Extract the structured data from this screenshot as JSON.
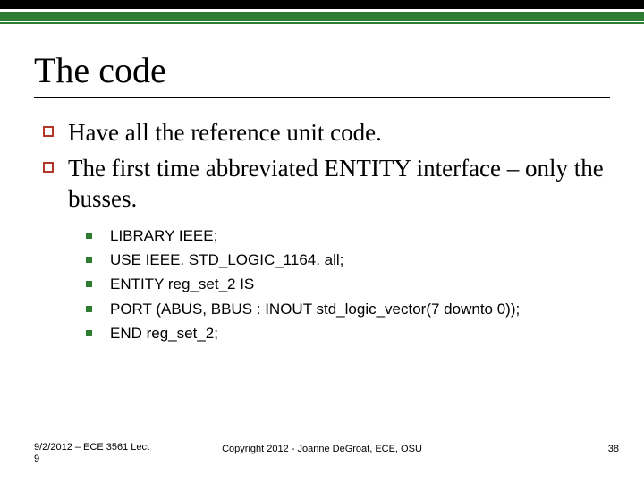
{
  "title": "The code",
  "bullets": [
    {
      "text": "Have all the reference unit code."
    },
    {
      "text": "The first time abbreviated ENTITY interface – only the busses."
    }
  ],
  "code_lines": [
    "LIBRARY IEEE;",
    "USE IEEE. STD_LOGIC_1164. all;",
    "ENTITY reg_set_2 IS",
    " PORT (ABUS, BBUS : INOUT std_logic_vector(7 downto 0));",
    "END reg_set_2;"
  ],
  "footer": {
    "left": "9/2/2012 – ECE 3561 Lect 9",
    "center": "Copyright 2012 - Joanne DeGroat, ECE, OSU",
    "right": "38"
  },
  "colors": {
    "accent_red": "#b23728",
    "accent_green": "#2e7d32"
  }
}
